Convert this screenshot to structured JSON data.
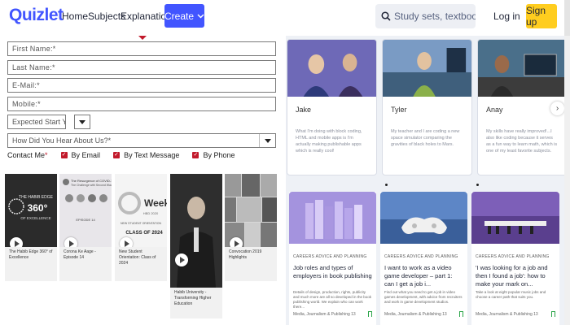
{
  "header": {
    "logo": "Quizlet",
    "nav": [
      "Home",
      "Subjects",
      "Explanations"
    ],
    "create_label": "Create",
    "search_placeholder": "Study sets, textbooks, ...",
    "login_label": "Log in",
    "signup_label": "Sign up"
  },
  "form": {
    "first_name": "First Name:*",
    "last_name": "Last Name:*",
    "email": "E-Mail:*",
    "mobile": "Mobile:*",
    "expected_start": "Expected Start Y",
    "hear_about": "How Did You Hear About Us?*",
    "contact_label": "Contact Me",
    "contact_req": "*",
    "options": [
      "By Email",
      "By Text Message",
      "By Phone"
    ]
  },
  "videos": [
    {
      "caption": "The Habib Edge 360° of Excellence",
      "thumb_text": "THE HABIB EDGE 360° OF EXCELLENCE"
    },
    {
      "caption": "Corona Ke Aage - Episode 14",
      "thumb_text": "The Resurgence of COVID-19: The Challenge with Second Wave"
    },
    {
      "caption": "New Student Orientation: Class of 2024",
      "thumb_text": "O-Week HBD 2020 NEW STUDENT ORIENTATION CLASS OF 2024"
    },
    {
      "caption": "Habib University - Transforming Higher Education",
      "thumb_text": ""
    },
    {
      "caption": "Convocation 2019 Highlights",
      "thumb_text": ""
    }
  ],
  "profiles": [
    {
      "name": "Jake",
      "quote": "What I'm doing with block coding, HTML and mobile apps is I'm actually making publishable apps which is really cool!"
    },
    {
      "name": "Tyler",
      "quote": "My teacher and I are coding a new space simulator comparing the gravities of black holes to Mars."
    },
    {
      "name": "Anay",
      "quote": "My skills have really improved!...I also like coding because it serves as a fun way to learn math, which is one of my least favorite subjects."
    }
  ],
  "articles": [
    {
      "category": "CAREERS ADVICE AND PLANNING",
      "title": "Job roles and types of employers in book publishing",
      "desc": "Details of design, production, rights, publicity and much more are all so developed in the book publishing world. We explain who can work there...",
      "footer": "Media, Journalism & Publishing 13"
    },
    {
      "category": "CAREERS ADVICE AND PLANNING",
      "title": "I want to work as a video game developer – part 1: can I get a job i...",
      "desc": "Find out what you need to get a job in video games development, with advice from recruiters and work in game development studios.",
      "footer": "Media, Journalism & Publishing 13"
    },
    {
      "category": "CAREERS ADVICE AND PLANNING",
      "title": "'I was looking for a job and then I found a job': how to make your mark on...",
      "desc": "Take a look at eight popular music jobs and choose a career path that suits you.",
      "footer": "Media, Journalism & Publishing 13"
    }
  ],
  "colors": {
    "brand": "#4255ff",
    "signup": "#ffcd1f",
    "accent_red": "#c21a2c",
    "bookmark": "#2aa548"
  }
}
